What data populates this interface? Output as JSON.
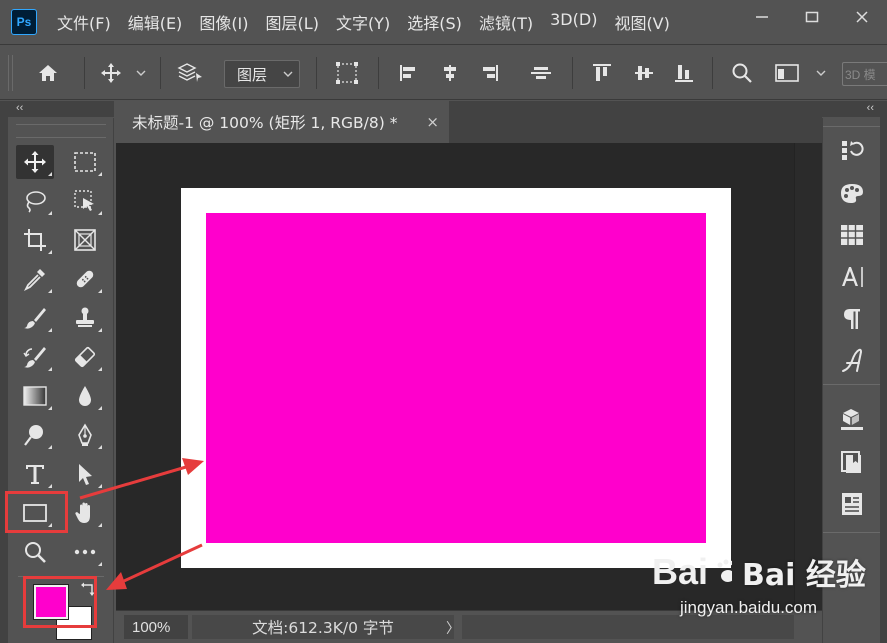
{
  "app": {
    "logo": "Ps"
  },
  "menu": {
    "items": [
      "文件(F)",
      "编辑(E)",
      "图像(I)",
      "图层(L)",
      "文字(Y)",
      "选择(S)",
      "滤镜(T)",
      "3D(D)",
      "视图(V)"
    ]
  },
  "window_controls": [
    "minimize-icon",
    "restore-icon",
    "close-icon"
  ],
  "options_bar": {
    "layer_select_value": "图层",
    "btn_3d_label": "3D 模"
  },
  "collapse": {
    "left": "‹‹",
    "right": "‹‹"
  },
  "document": {
    "tab_title": "未标题-1 @ 100% (矩形 1, RGB/8) *",
    "tab_close": "×"
  },
  "canvas": {
    "background_color": "#ffffff",
    "rectangle_color": "#ff00cc"
  },
  "status": {
    "zoom": "100%",
    "doc_info": "文档:612.3K/0 字节",
    "arrow": "〉"
  },
  "colors": {
    "foreground": "#ff00cc",
    "background": "#ffffff",
    "highlight": "#e63c3c"
  },
  "tools": [
    "move-tool",
    "marquee-tool",
    "lasso-tool",
    "object-select-tool",
    "crop-tool",
    "frame-tool",
    "eyedropper-tool",
    "healing-brush-tool",
    "brush-tool",
    "clone-stamp-tool",
    "history-brush-tool",
    "eraser-tool",
    "gradient-tool",
    "blur-tool",
    "dodge-tool",
    "pen-tool",
    "type-tool",
    "path-select-tool",
    "rectangle-tool",
    "hand-tool",
    "zoom-tool",
    "more-tools"
  ],
  "right_panel_icons": [
    "history-icon",
    "color-icon",
    "swatches-icon",
    "character-icon",
    "paragraph-icon",
    "glyphs-icon",
    "3d-panel-icon",
    "libraries-icon",
    "properties-icon"
  ],
  "watermark": {
    "text": "Bai 经验",
    "url": "jingyan.baidu.com"
  }
}
